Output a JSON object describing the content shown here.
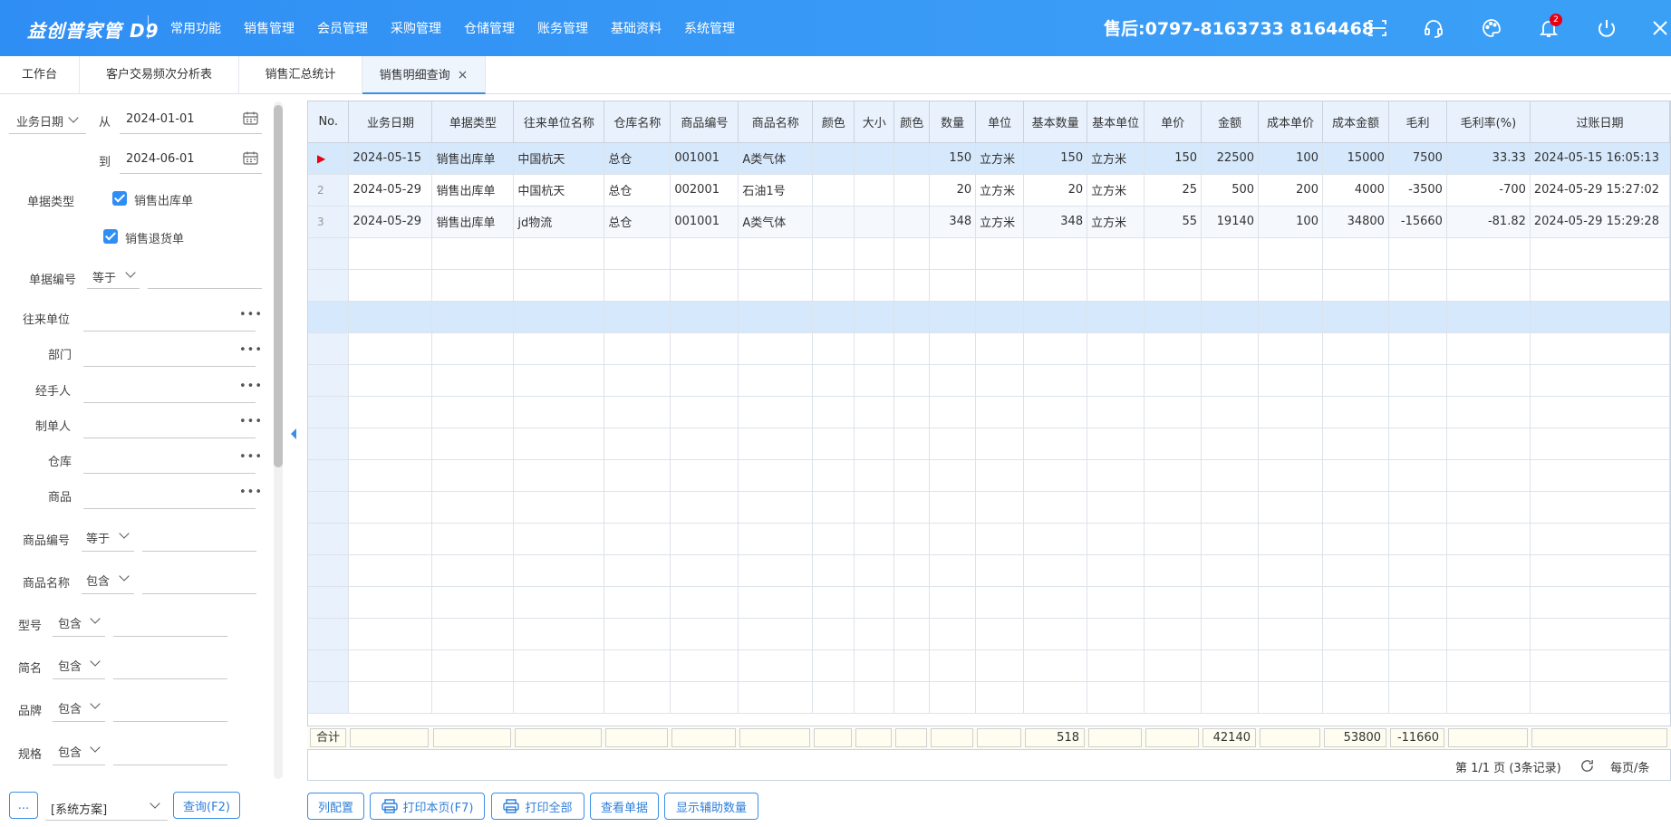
{
  "app": {
    "logo": "益创普家管 D9",
    "hotline": "售后:0797-8163733  8164468",
    "notification_count": "2",
    "accent": "#2f8ef4"
  },
  "topnav": [
    "常用功能",
    "销售管理",
    "会员管理",
    "采购管理",
    "仓储管理",
    "账务管理",
    "基础资料",
    "系统管理"
  ],
  "tabs": [
    {
      "label": "工作台"
    },
    {
      "label": "客户交易频次分析表"
    },
    {
      "label": "销售汇总统计"
    },
    {
      "label": "销售明细查询",
      "close": "×"
    }
  ],
  "filter": {
    "date_type": "业务日期",
    "from_label": "从",
    "from_date": "2024-01-01",
    "to_label": "到",
    "to_date": "2024-06-01",
    "doc_type_label": "单据类型",
    "doc_type_option1": "销售出库单",
    "doc_type_option2": "销售退货单",
    "doc_no_label": "单据编号",
    "doc_no_op": "等于",
    "partner_label": "往来单位",
    "dept_label": "部门",
    "handler_label": "经手人",
    "creator_label": "制单人",
    "warehouse_label": "仓库",
    "product_label": "商品",
    "product_code_label": "商品编号",
    "product_code_op": "等于",
    "product_name_label": "商品名称",
    "product_name_op": "包含",
    "model_label": "型号",
    "model_op": "包含",
    "short_name_label": "简名",
    "short_name_op": "包含",
    "brand_label": "品牌",
    "brand_op": "包含",
    "spec_label": "规格",
    "spec_op": "包含",
    "more_dots": "•••"
  },
  "bottom_left": {
    "more_button": "...",
    "scheme": "[系统方案]",
    "query_button": "查询(F2)"
  },
  "grid": {
    "columns": [
      "No.",
      "业务日期",
      "单据类型",
      "往来单位名称",
      "仓库名称",
      "商品编号",
      "商品名称",
      "颜色",
      "大小",
      "颜色",
      "数量",
      "单位",
      "基本数量",
      "基本单位",
      "单价",
      "金额",
      "成本单价",
      "成本金额",
      "毛利",
      "毛利率(%)",
      "过账日期"
    ],
    "rows": [
      {
        "no": "▶",
        "date": "2024-05-15",
        "type": "销售出库单",
        "partner": "中国杭天",
        "warehouse": "总仓",
        "code": "001001",
        "name": "A类气体",
        "color": "",
        "size": "",
        "color2": "",
        "qty": "150",
        "unit": "立方米",
        "base_qty": "150",
        "base_unit": "立方米",
        "price": "150",
        "amount": "22500",
        "cost_price": "100",
        "cost_amount": "15000",
        "profit": "7500",
        "margin": "33.33",
        "post_date": "2024-05-15 16:05:13"
      },
      {
        "no": "2",
        "date": "2024-05-29",
        "type": "销售出库单",
        "partner": "中国杭天",
        "warehouse": "总仓",
        "code": "002001",
        "name": "石油1号",
        "color": "",
        "size": "",
        "color2": "",
        "qty": "20",
        "unit": "立方米",
        "base_qty": "20",
        "base_unit": "立方米",
        "price": "25",
        "amount": "500",
        "cost_price": "200",
        "cost_amount": "4000",
        "profit": "-3500",
        "margin": "-700",
        "post_date": "2024-05-29 15:27:02"
      },
      {
        "no": "3",
        "date": "2024-05-29",
        "type": "销售出库单",
        "partner": "jd物流",
        "warehouse": "总仓",
        "code": "001001",
        "name": "A类气体",
        "color": "",
        "size": "",
        "color2": "",
        "qty": "348",
        "unit": "立方米",
        "base_qty": "348",
        "base_unit": "立方米",
        "price": "55",
        "amount": "19140",
        "cost_price": "100",
        "cost_amount": "34800",
        "profit": "-15660",
        "margin": "-81.82",
        "post_date": "2024-05-29 15:29:28"
      }
    ],
    "summary": {
      "label": "合计",
      "base_qty": "518",
      "amount": "42140",
      "cost_amount": "53800",
      "profit": "-11660"
    }
  },
  "pager": {
    "info": "第 1/1 页 (3条记录)",
    "per_page": "每页/条"
  },
  "bottom_buttons": [
    "列配置",
    "打印本页(F7)",
    "打印全部",
    "查看单据",
    "显示辅助数量"
  ]
}
